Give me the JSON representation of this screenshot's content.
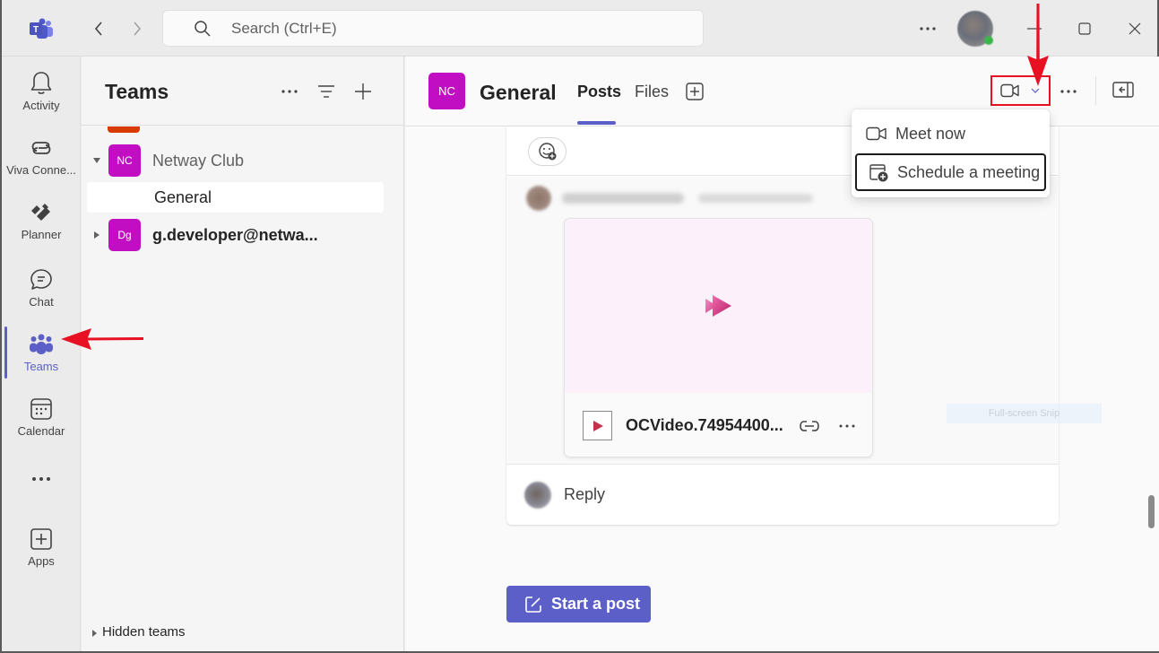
{
  "titlebar": {
    "search_placeholder": "Search (Ctrl+E)",
    "icons": {
      "logo": "teams-logo-icon",
      "back": "chevron-left-icon",
      "forward": "chevron-right-icon",
      "search": "search-icon",
      "more": "more-horizontal-icon",
      "minimize": "minimize-icon",
      "maximize": "maximize-icon",
      "close": "close-icon"
    }
  },
  "rail": {
    "items": [
      {
        "label": "Activity",
        "icon": "bell-icon"
      },
      {
        "label": "Viva Conne...",
        "icon": "viva-connections-icon"
      },
      {
        "label": "Planner",
        "icon": "planner-icon"
      },
      {
        "label": "Chat",
        "icon": "chat-icon"
      },
      {
        "label": "Teams",
        "icon": "teams-icon",
        "active": true
      },
      {
        "label": "Calendar",
        "icon": "calendar-icon"
      },
      {
        "label": "",
        "icon": "more-horizontal-icon"
      },
      {
        "label": "Apps",
        "icon": "add-app-icon"
      }
    ]
  },
  "teams_pane": {
    "title": "Teams",
    "teams": [
      {
        "initials": "NC",
        "name": "Netway Club",
        "expanded": true,
        "color": "#c20ec2",
        "channels": [
          {
            "name": "General",
            "selected": true
          }
        ]
      },
      {
        "initials": "Dg",
        "name": "g.developer@netwa...",
        "expanded": false,
        "color": "#c20ec2"
      }
    ],
    "hidden_teams_label": "Hidden teams"
  },
  "channel": {
    "avatar_initials": "NC",
    "title": "General",
    "tabs": [
      {
        "label": "Posts",
        "active": true
      },
      {
        "label": "Files",
        "active": false
      }
    ],
    "post": {
      "attachment": {
        "file_name": "OCVideo.74954400..."
      },
      "reply_label": "Reply"
    },
    "start_post_label": "Start a post",
    "snip_hint": "Full-screen Snip"
  },
  "meeting_menu": {
    "items": [
      {
        "label": "Meet now",
        "icon": "video-camera-icon"
      },
      {
        "label": "Schedule a meeting",
        "icon": "calendar-add-icon",
        "focused": true
      }
    ]
  },
  "colors": {
    "brand": "#5b5fc7",
    "team_avatar": "#c20ec2",
    "annotation": "#e81123"
  }
}
